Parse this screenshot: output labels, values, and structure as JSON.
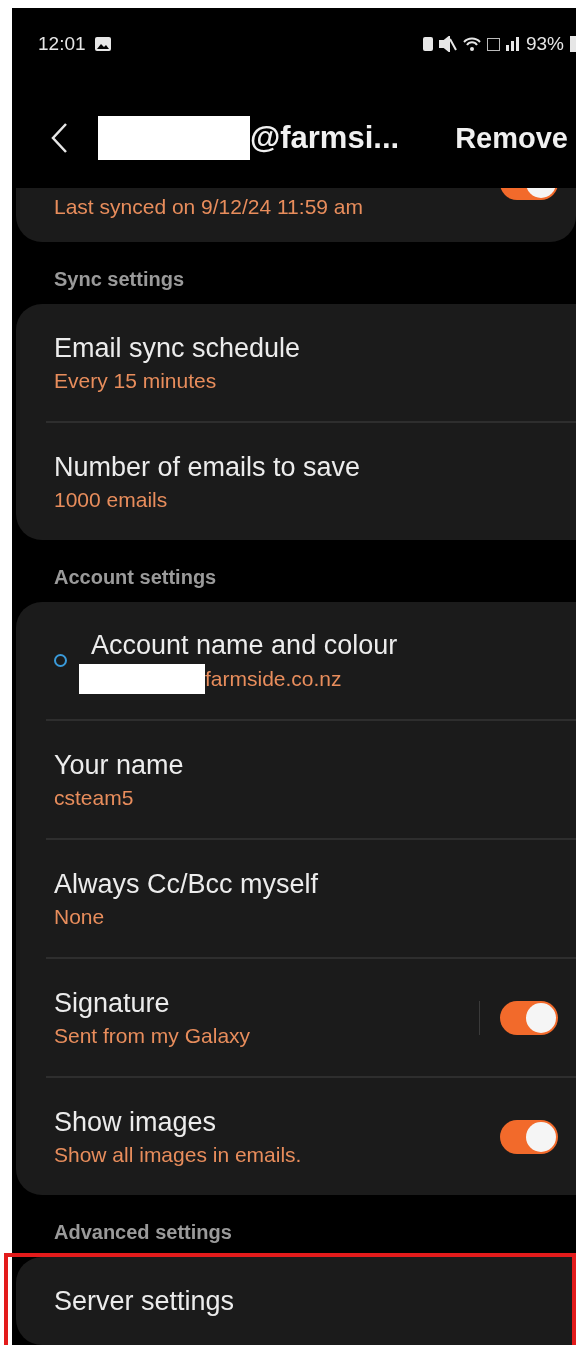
{
  "status_bar": {
    "time": "12:01",
    "battery": "93%"
  },
  "header": {
    "title": "@farmsi...",
    "title_redacted": true,
    "action": "Remove"
  },
  "top_card": {
    "subtitle": "Last synced on 9/12/24  11:59 am",
    "on": true
  },
  "sections": [
    {
      "heading": "Sync settings",
      "items": [
        {
          "kind": "text",
          "title": "Email sync schedule",
          "subtitle": "Every 15 minutes"
        },
        {
          "kind": "text",
          "title": "Number of emails to save",
          "subtitle": "1000 emails"
        }
      ]
    },
    {
      "heading": "Account settings",
      "items": [
        {
          "kind": "account",
          "title": "Account name and colour",
          "subtitle": "farmside.co.nz",
          "redacted": true,
          "color": "#3a9ad9"
        },
        {
          "kind": "text",
          "title": "Your name",
          "subtitle": "csteam5"
        },
        {
          "kind": "text",
          "title": "Always Cc/Bcc myself",
          "subtitle": "None"
        },
        {
          "kind": "switch",
          "title": "Signature",
          "subtitle": "Sent from my Galaxy",
          "on": true,
          "divider": true
        },
        {
          "kind": "switch",
          "title": "Show images",
          "subtitle": "Show all images in emails.",
          "on": true,
          "divider": false
        }
      ]
    },
    {
      "heading": "Advanced settings",
      "highlighted": true,
      "items": [
        {
          "kind": "text",
          "title": "Server settings"
        }
      ]
    }
  ]
}
